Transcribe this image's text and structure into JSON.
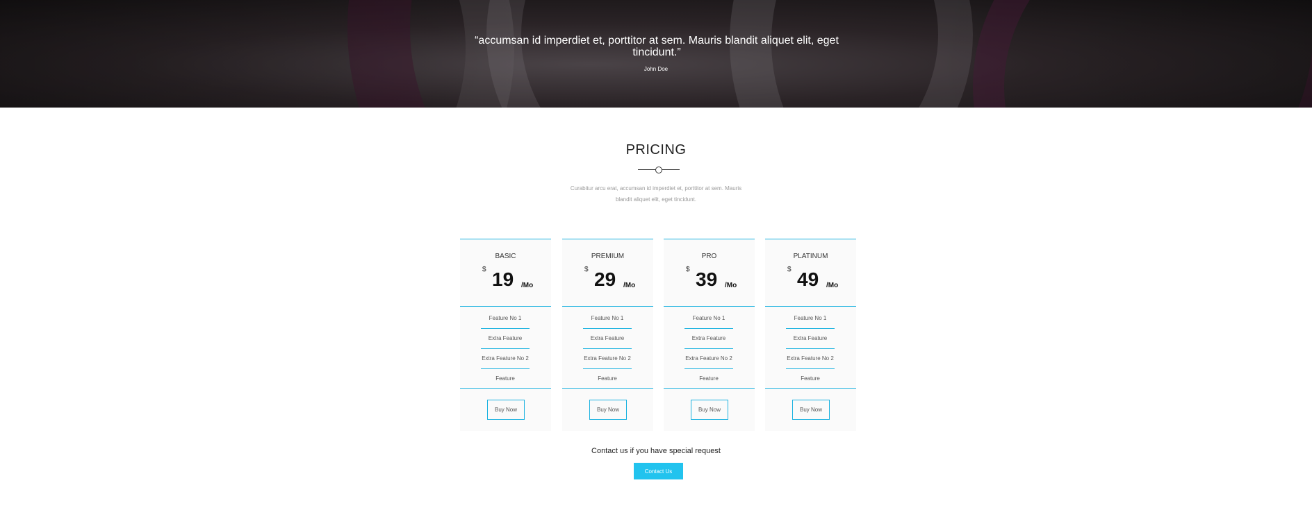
{
  "testimonial": {
    "quote": "“accumsan id imperdiet et, porttitor at sem. Mauris blandit aliquet elit, eget tincidunt.”",
    "author": "John Doe"
  },
  "pricing": {
    "title": "PRICING",
    "subtitle": "Curabitur arcu erat, accumsan id imperdiet et, porttitor at sem. Mauris blandit aliquet elit, eget tincidunt.",
    "currency": "$",
    "period": "/Mo",
    "features": [
      "Feature No 1",
      "Extra Feature",
      "Extra Feature No 2",
      "Feature"
    ],
    "buy_label": "Buy Now",
    "plans": [
      {
        "name": "BASIC",
        "price": "19"
      },
      {
        "name": "PREMIUM",
        "price": "29"
      },
      {
        "name": "PRO",
        "price": "39"
      },
      {
        "name": "PLATINUM",
        "price": "49"
      }
    ]
  },
  "contact": {
    "text": "Contact us if you have special request",
    "button_label": "Contact Us"
  },
  "colors": {
    "accent": "#1ab2e0",
    "contact_button": "#22c3ee"
  }
}
